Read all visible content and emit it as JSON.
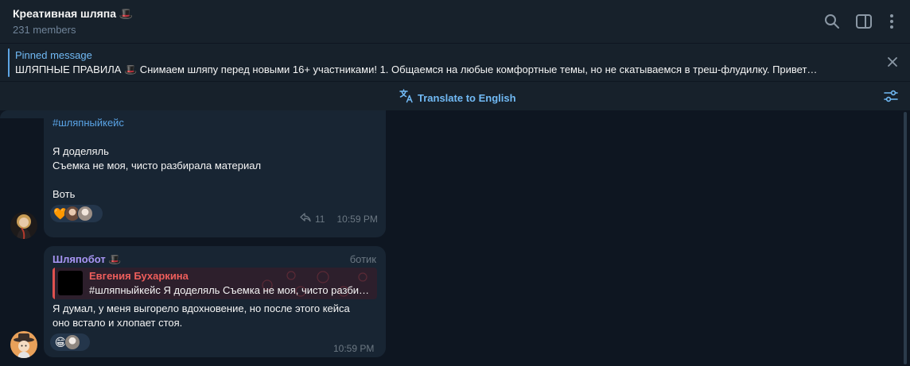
{
  "header": {
    "title": "Креативная шляпа 🎩",
    "members": "231 members",
    "icons": [
      "search-icon",
      "sidebar-toggle-icon",
      "more-vertical-icon"
    ]
  },
  "pinned": {
    "label": "Pinned message",
    "text": "ШЛЯПНЫЕ ПРАВИЛА 🎩    Снимаем шляпу перед новыми 16+ участниками!     1. Общаемся на любые комфортные темы, но не скатываемся в треш-флудилку. Привет…"
  },
  "translate": {
    "label": "Translate to English"
  },
  "messages": [
    {
      "hashtag": "#шляпныйкейс",
      "lines": [
        "Я доделяль",
        "Съемка не моя, чисто разбирала материал",
        "Воть"
      ],
      "media_progress": 0.105,
      "reactions": [
        "🧡",
        "avatar",
        "avatar"
      ],
      "forwards": "11",
      "time": "10:59 PM"
    },
    {
      "sender": "Шляпобот 🎩",
      "badge": "ботик",
      "reply": {
        "name": "Евгения Бухаркина",
        "text": "#шляпныйкейс  Я доделяль Съемка не моя, чисто разбирала материал Воть"
      },
      "lines": [
        "Я думал, у меня выгорело вдохновение, но после этого кейса",
        "оно встало и хлопает стоя."
      ],
      "reactions": [
        "😁",
        "avatar"
      ],
      "time": "10:59 PM"
    }
  ],
  "colors": {
    "background": "#0e1621",
    "panel": "#17212b",
    "bubble": "#182533",
    "accent": "#71baf5",
    "sender": "#a996f5",
    "reply_name": "#ee5e5b"
  }
}
